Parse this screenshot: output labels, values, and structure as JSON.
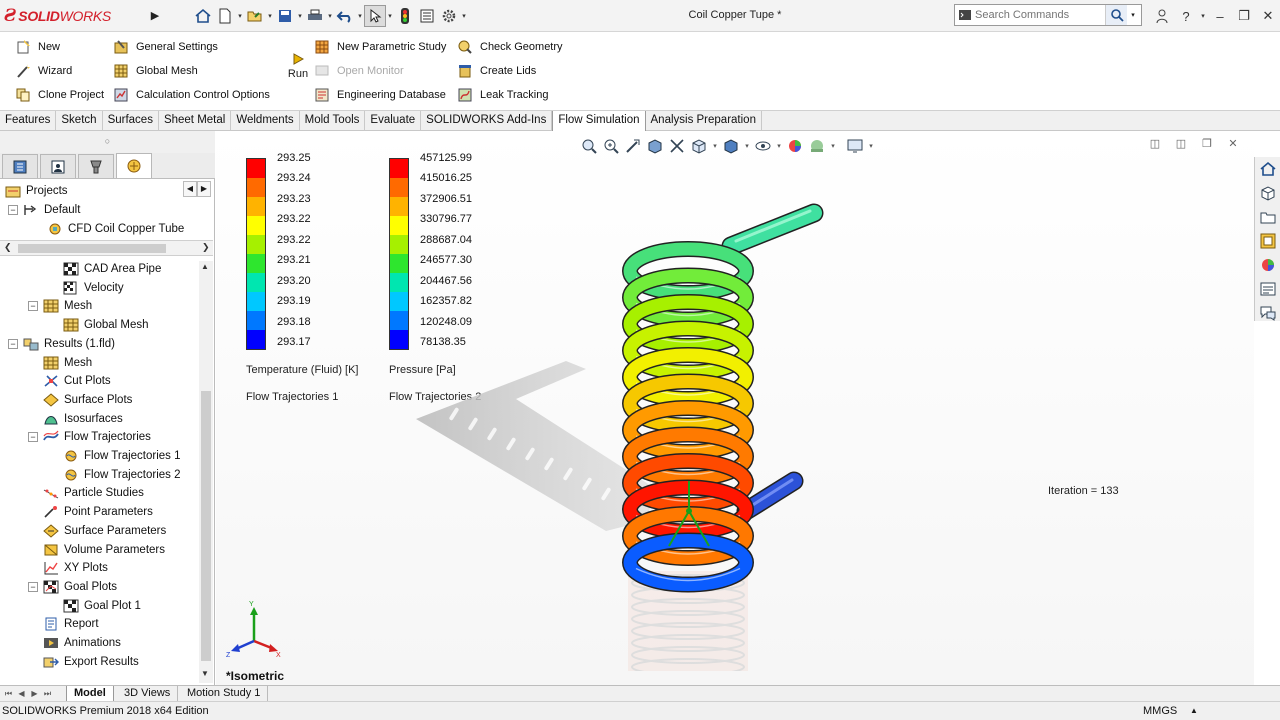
{
  "titlebar": {
    "brand_prefix": "SOLID",
    "brand_suffix": "WORKS",
    "document_title": "Coil Copper Tupe *",
    "search_placeholder": "Search Commands",
    "icons": [
      "home-icon",
      "new-doc-icon",
      "open-icon",
      "save-icon",
      "print-icon",
      "undo-icon",
      "select-icon",
      "traffic-light-icon",
      "file-properties-icon",
      "options-gear-icon"
    ],
    "window_icons": [
      "user-icon",
      "help-icon",
      "minimize-icon",
      "restore-icon",
      "close-icon"
    ]
  },
  "ribbon": {
    "col1": [
      {
        "label": "New",
        "icon": "new-project-icon"
      },
      {
        "label": "Wizard",
        "icon": "wizard-icon"
      },
      {
        "label": "Clone Project",
        "icon": "clone-project-icon"
      }
    ],
    "col2": [
      {
        "label": "General Settings",
        "icon": "general-settings-icon"
      },
      {
        "label": "Global Mesh",
        "icon": "global-mesh-icon"
      },
      {
        "label": "Calculation Control Options",
        "icon": "calc-control-icon"
      }
    ],
    "run_label": "Run",
    "col3": [
      {
        "label": "New Parametric Study",
        "icon": "parametric-study-icon"
      },
      {
        "label": "Open Monitor",
        "icon": "monitor-icon",
        "disabled": true
      },
      {
        "label": "Engineering Database",
        "icon": "database-icon"
      }
    ],
    "col4": [
      {
        "label": "Check Geometry",
        "icon": "check-geometry-icon"
      },
      {
        "label": "Create Lids",
        "icon": "create-lids-icon"
      },
      {
        "label": "Leak Tracking",
        "icon": "leak-tracking-icon"
      }
    ]
  },
  "tabs": [
    "Features",
    "Sketch",
    "Surfaces",
    "Sheet Metal",
    "Weldments",
    "Mold Tools",
    "Evaluate",
    "SOLIDWORKS Add-Ins",
    "Flow Simulation",
    "Analysis Preparation"
  ],
  "active_tab": "Flow Simulation",
  "tree_top": [
    {
      "label": "Projects",
      "level": 0
    },
    {
      "label": "Default",
      "level": 1,
      "expander": "−"
    },
    {
      "label": "CFD Coil Copper Tube",
      "level": 2
    }
  ],
  "tree": [
    {
      "label": "CAD Area Pipe",
      "level": 3
    },
    {
      "label": "Velocity",
      "level": 3
    },
    {
      "label": "Mesh",
      "level": 2,
      "expander": "−"
    },
    {
      "label": "Global Mesh",
      "level": 3
    },
    {
      "label": "Results (1.fld)",
      "level": 1,
      "expander": "−"
    },
    {
      "label": "Mesh",
      "level": 2
    },
    {
      "label": "Cut Plots",
      "level": 2
    },
    {
      "label": "Surface Plots",
      "level": 2
    },
    {
      "label": "Isosurfaces",
      "level": 2
    },
    {
      "label": "Flow Trajectories",
      "level": 2,
      "expander": "−"
    },
    {
      "label": "Flow Trajectories 1",
      "level": 3
    },
    {
      "label": "Flow Trajectories 2",
      "level": 3
    },
    {
      "label": "Particle Studies",
      "level": 2
    },
    {
      "label": "Point Parameters",
      "level": 2
    },
    {
      "label": "Surface Parameters",
      "level": 2
    },
    {
      "label": "Volume Parameters",
      "level": 2
    },
    {
      "label": "XY Plots",
      "level": 2
    },
    {
      "label": "Goal Plots",
      "level": 2,
      "expander": "−"
    },
    {
      "label": "Goal Plot 1",
      "level": 3
    },
    {
      "label": "Report",
      "level": 2
    },
    {
      "label": "Animations",
      "level": 2
    },
    {
      "label": "Export Results",
      "level": 2
    }
  ],
  "legend_colors": [
    "#ff0000",
    "#ff6a00",
    "#ffb300",
    "#ffff00",
    "#a6f000",
    "#2ee62e",
    "#00e6b0",
    "#00c8ff",
    "#0078ff",
    "#0000ff"
  ],
  "legend_temperature": {
    "values": [
      "293.25",
      "293.24",
      "293.23",
      "293.22",
      "293.22",
      "293.21",
      "293.20",
      "293.19",
      "293.18",
      "293.17"
    ],
    "title": "Temperature (Fluid) [K]",
    "subtitle": "Flow Trajectories 1"
  },
  "legend_pressure": {
    "values": [
      "457125.99",
      "415016.25",
      "372906.51",
      "330796.77",
      "288687.04",
      "246577.30",
      "204467.56",
      "162357.82",
      "120248.09",
      "78138.35"
    ],
    "title": "Pressure [Pa]",
    "subtitle": "Flow Trajectories 2"
  },
  "viewport": {
    "iteration": "Iteration = 133",
    "view_name": "*Isometric"
  },
  "bottom_tabs": [
    "Model",
    "3D Views",
    "Motion Study 1"
  ],
  "status": {
    "edition": "SOLIDWORKS Premium 2018 x64 Edition",
    "units": "MMGS"
  }
}
